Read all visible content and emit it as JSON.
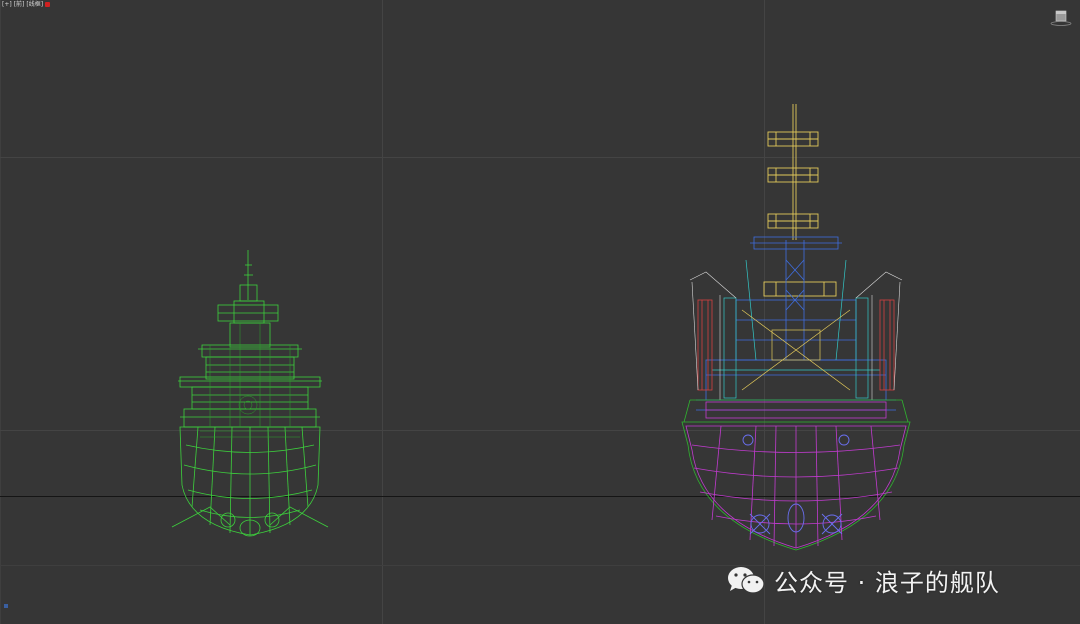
{
  "viewport": {
    "label_parts": [
      "[+]",
      "[前]",
      "[线框]"
    ],
    "background": "#363636"
  },
  "icons": {
    "viewcube": "viewcube-icon",
    "wechat": "wechat-logo-icon"
  },
  "colors": {
    "left_ship": "#3dd13d",
    "hull_magenta": "#c23bd0",
    "superstructure_blue": "#3f6ee0",
    "mast_yellow": "#e2c95a",
    "cyan": "#33c8c8",
    "red": "#d54040",
    "green_outline": "#2fb52f"
  },
  "watermark": {
    "text": "公众号 · 浪子的舰队"
  }
}
